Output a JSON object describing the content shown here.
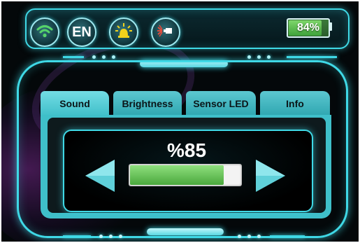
{
  "status_bar": {
    "icons": [
      {
        "name": "wifi-icon"
      },
      {
        "name": "language-icon",
        "label": "EN"
      },
      {
        "name": "light-bulb-icon"
      },
      {
        "name": "sensor-led-icon"
      }
    ],
    "battery": {
      "label": "84%",
      "level": 0.84
    }
  },
  "tabs": [
    {
      "label": "Sound",
      "active": true
    },
    {
      "label": "Brightness",
      "active": false
    },
    {
      "label": "Sensor LED",
      "active": false
    },
    {
      "label": "Info",
      "active": false
    }
  ],
  "sound": {
    "value_label": "%85",
    "level": 0.85
  },
  "colors": {
    "accent": "#3fd9e6",
    "tab": "#5cc7d0",
    "bar_fill": "#6cc85a",
    "background": "#04080a"
  }
}
